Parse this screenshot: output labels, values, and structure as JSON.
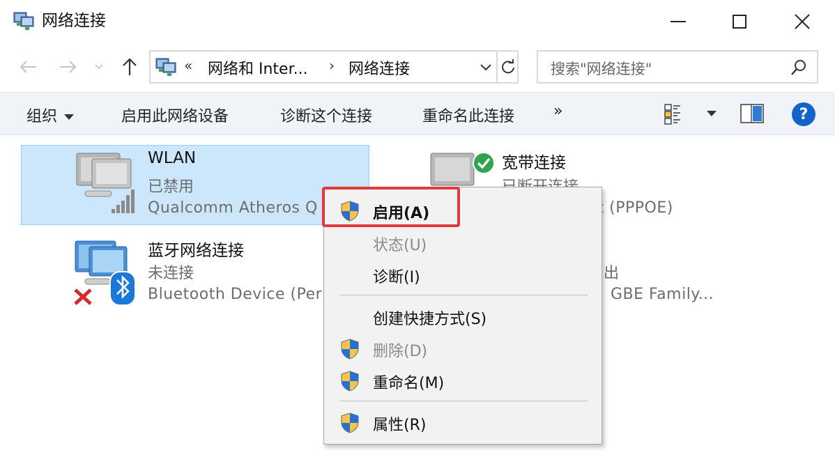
{
  "window": {
    "title": "网络连接"
  },
  "address": {
    "chevrons": "«",
    "segment1": "网络和 Inter...",
    "separator": "›",
    "segment2": "网络连接"
  },
  "search": {
    "placeholder": "搜索\"网络连接\""
  },
  "commands": {
    "organize": "组织",
    "enable_device": "启用此网络设备",
    "diagnose": "诊断这个连接",
    "rename": "重命名此连接",
    "more": "»",
    "help": "?"
  },
  "connections": [
    {
      "name": "WLAN",
      "status": "已禁用",
      "device": "Qualcomm Atheros Q"
    },
    {
      "name": "宽带连接",
      "status": "已断开连接",
      "device": "rt (PPPOE)"
    },
    {
      "name": "蓝牙网络连接",
      "status": "未连接",
      "device": "Bluetooth Device (Per"
    },
    {
      "name": "",
      "status": "出",
      "device": "GBE Family..."
    }
  ],
  "context_menu": [
    {
      "label": "启用(A)",
      "shield": true,
      "bold": true,
      "disabled": false
    },
    {
      "label": "状态(U)",
      "shield": false,
      "bold": false,
      "disabled": true
    },
    {
      "label": "诊断(I)",
      "shield": false,
      "bold": false,
      "disabled": false
    },
    {
      "label": "创建快捷方式(S)",
      "shield": false,
      "bold": false,
      "disabled": false
    },
    {
      "label": "删除(D)",
      "shield": true,
      "bold": false,
      "disabled": true
    },
    {
      "label": "重命名(M)",
      "shield": true,
      "bold": false,
      "disabled": false
    },
    {
      "label": "属性(R)",
      "shield": true,
      "bold": false,
      "disabled": false
    }
  ],
  "colors": {
    "selection": "#cce6fb",
    "highlight_border": "#e03b3b",
    "help_blue": "#1463c9"
  }
}
